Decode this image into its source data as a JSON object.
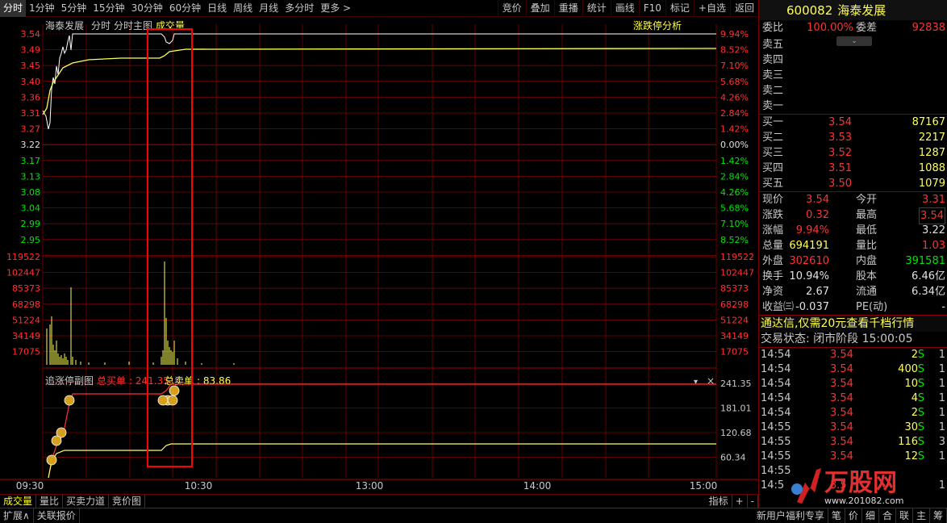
{
  "toolbar": {
    "tabs": [
      "分时",
      "1分钟",
      "5分钟",
      "15分钟",
      "30分钟",
      "60分钟",
      "日线",
      "周线",
      "月线",
      "多分时",
      "更多 >"
    ],
    "buttons": [
      "竞价",
      "叠加",
      "重播",
      "统计",
      "画线",
      "F10",
      "标记",
      "+自选",
      "返回"
    ]
  },
  "chart": {
    "stock_name": "海泰发展",
    "labels": [
      "分时",
      "分时主图",
      "成交量"
    ],
    "limit_analysis": "涨跌停分析",
    "price_ticks": [
      "3.54",
      "3.49",
      "3.45",
      "3.40",
      "3.36",
      "3.31",
      "3.27",
      "3.22",
      "3.17",
      "3.13",
      "3.08",
      "3.04",
      "2.99",
      "2.95"
    ],
    "pct_ticks": [
      "9.94%",
      "8.52%",
      "7.10%",
      "5.68%",
      "4.26%",
      "2.84%",
      "1.42%",
      "0.00%",
      "1.42%",
      "2.84%",
      "4.26%",
      "5.68%",
      "7.10%",
      "8.52%"
    ],
    "vol_ticks": [
      "119522",
      "102447",
      "85373",
      "68298",
      "51224",
      "34149",
      "17075"
    ],
    "sub_title": "追涨停副图",
    "sub_buy_label": "总买单",
    "sub_buy_value": "241.35",
    "sub_sell_label": "总卖单",
    "sub_sell_value": "83.86",
    "sub_ticks": [
      "241.35",
      "181.01",
      "120.68",
      "60.34"
    ],
    "time_ticks": [
      "09:30",
      "10:30",
      "13:00",
      "14:00",
      "15:00"
    ]
  },
  "bottom_tabs": [
    "成交量",
    "量比",
    "买卖力道",
    "竞价图"
  ],
  "bottom_right": [
    "指标",
    "+",
    "-"
  ],
  "status_bar": {
    "left": [
      "扩展∧",
      "关联报价"
    ],
    "right": [
      "新用户福利专享",
      "笔",
      "价",
      "细",
      "合",
      "联",
      "主",
      "筹"
    ]
  },
  "quote": {
    "code": "600082",
    "name": "海泰发展",
    "weibi_label": "委比",
    "weibi": "100.00%",
    "weicha_label": "委差",
    "weicha": "92838",
    "sell": [
      {
        "label": "卖五"
      },
      {
        "label": "卖四"
      },
      {
        "label": "卖三"
      },
      {
        "label": "卖二"
      },
      {
        "label": "卖一"
      }
    ],
    "buy": [
      {
        "label": "买一",
        "price": "3.54",
        "vol": "87167"
      },
      {
        "label": "买二",
        "price": "3.53",
        "vol": "2217"
      },
      {
        "label": "买三",
        "price": "3.52",
        "vol": "1287"
      },
      {
        "label": "买四",
        "price": "3.51",
        "vol": "1088"
      },
      {
        "label": "买五",
        "price": "3.50",
        "vol": "1079"
      }
    ],
    "stats": [
      {
        "l": "现价",
        "v": "3.54",
        "vc": "red",
        "l2": "今开",
        "v2": "3.31",
        "v2c": "red"
      },
      {
        "l": "涨跌",
        "v": "0.32",
        "vc": "red",
        "l2": "最高",
        "v2": "3.54",
        "v2c": "red"
      },
      {
        "l": "涨幅",
        "v": "9.94%",
        "vc": "red",
        "l2": "最低",
        "v2": "3.22",
        "v2c": "white"
      },
      {
        "l": "总量",
        "v": "694191",
        "vc": "yellow",
        "l2": "量比",
        "v2": "1.03",
        "v2c": "red"
      },
      {
        "l": "外盘",
        "v": "302610",
        "vc": "red",
        "l2": "内盘",
        "v2": "391581",
        "v2c": "green"
      },
      {
        "l": "换手",
        "v": "10.94%",
        "vc": "white",
        "l2": "股本",
        "v2": "6.46亿",
        "v2c": "white"
      },
      {
        "l": "净资",
        "v": "2.67",
        "vc": "white",
        "l2": "流通",
        "v2": "6.34亿",
        "v2c": "white"
      },
      {
        "l": "收益㈢",
        "v": "-0.037",
        "vc": "white",
        "l2": "PE(动)",
        "v2": "-",
        "v2c": "white"
      }
    ],
    "promo": "通达信,仅需20元查看千档行情",
    "trade_status": "交易状态: 闭市阶段 15:00:05",
    "ticks": [
      {
        "t": "14:54",
        "p": "3.54",
        "q": "2",
        "s": "S",
        "x": "1"
      },
      {
        "t": "14:54",
        "p": "3.54",
        "q": "400",
        "s": "S",
        "x": "1"
      },
      {
        "t": "14:54",
        "p": "3.54",
        "q": "10",
        "s": "S",
        "x": "1"
      },
      {
        "t": "14:54",
        "p": "3.54",
        "q": "4",
        "s": "S",
        "x": "1"
      },
      {
        "t": "14:54",
        "p": "3.54",
        "q": "2",
        "s": "S",
        "x": "1"
      },
      {
        "t": "14:55",
        "p": "3.54",
        "q": "30",
        "s": "S",
        "x": "1"
      },
      {
        "t": "14:55",
        "p": "3.54",
        "q": "116",
        "s": "S",
        "x": "3"
      },
      {
        "t": "14:55",
        "p": "3.54",
        "q": "12",
        "s": "S",
        "x": "1"
      },
      {
        "t": "14:55",
        "p": "",
        "q": "",
        "s": "",
        "x": ""
      },
      {
        "t": "14:5",
        "p": "3.5",
        "q": "",
        "s": "",
        "x": "1"
      }
    ]
  },
  "watermark": {
    "brand": "万股网",
    "url": "www.201082.com"
  },
  "colors": {
    "up": "#ff3232",
    "down": "#00e600",
    "price_line": "#ffffff",
    "avg_line": "#ffff54",
    "grid": "#800000",
    "highlight": "#ff0000"
  }
}
